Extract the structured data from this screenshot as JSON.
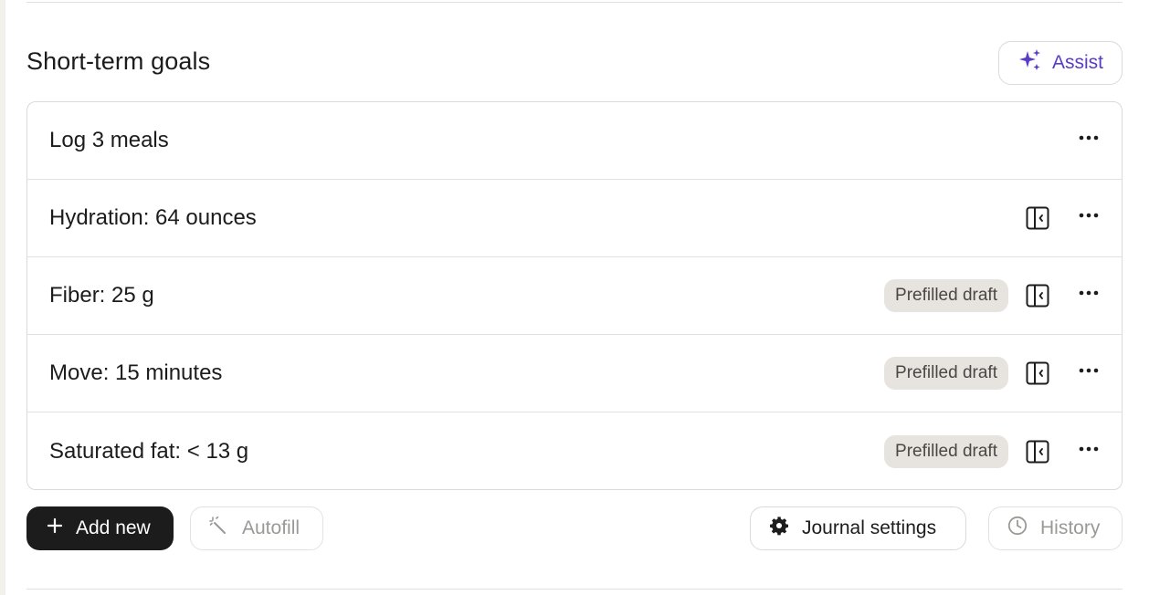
{
  "section": {
    "title": "Short-term goals",
    "assist_label": "Assist"
  },
  "goals": [
    {
      "label": "Log 3 meals",
      "badge": "",
      "has_panel_icon": false
    },
    {
      "label": "Hydration: 64 ounces",
      "badge": "",
      "has_panel_icon": true
    },
    {
      "label": "Fiber: 25 g",
      "badge": "Prefilled draft",
      "has_panel_icon": true
    },
    {
      "label": "Move: 15 minutes",
      "badge": "Prefilled draft",
      "has_panel_icon": true
    },
    {
      "label": "Saturated fat: < 13 g",
      "badge": "Prefilled draft",
      "has_panel_icon": true
    }
  ],
  "footer": {
    "add_label": "Add new",
    "autofill_label": "Autofill",
    "journal_settings_label": "Journal settings",
    "history_label": "History"
  },
  "icons": {
    "assist": "sparkle-icon",
    "row_panel": "side-panel-icon",
    "row_more": "more-horizontal-icon",
    "add": "plus-icon",
    "autofill": "magic-wand-icon",
    "journal_settings": "gear-icon",
    "history": "clock-icon"
  },
  "colors": {
    "accent": "#5b3cc4",
    "primary_button": "#1c1c1c",
    "badge_bg": "#e7e3de",
    "disabled_text": "#9b9996"
  }
}
